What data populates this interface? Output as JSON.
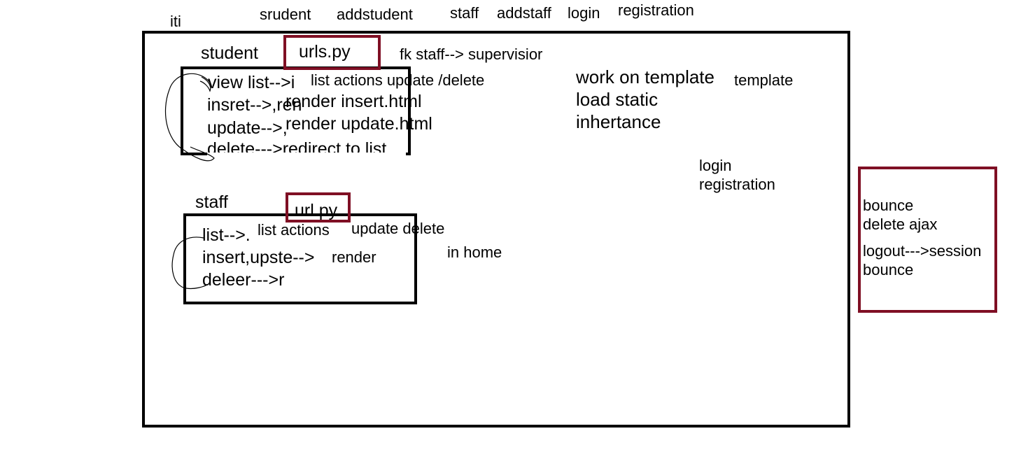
{
  "title": "iti",
  "top_nav": [
    "srudent",
    "addstudent",
    "staff",
    "addstaff",
    "login",
    "registration"
  ],
  "student": {
    "heading": "student",
    "urls_label": "urls.py",
    "fk_note": "fk staff--> supervisior",
    "list_actions": "list actions update /delete",
    "items": [
      "view list-->i",
      "insret-->,ren",
      "update-->,",
      "delete--->redirect to list"
    ],
    "render_insert": "render insert.html",
    "render_update": "render update.html"
  },
  "template_notes": {
    "work": "work on template",
    "load": "load static",
    "inh": "inhertance",
    "template_label": "template"
  },
  "auth_notes": {
    "login": "login",
    "registration": "registration"
  },
  "staff": {
    "heading": "staff",
    "url_label": "url.py",
    "list_actions": "list actions",
    "update_delete": "update delete",
    "items": [
      "list-->.",
      "insert,upste-->",
      "deleer--->r"
    ],
    "render": "render",
    "in_home": "in home"
  },
  "side": {
    "bounce1": "bounce",
    "delete_ajax": "delete ajax",
    "logout": "logout--->session",
    "bounce2": "bounce"
  },
  "colors": {
    "ink": "#000000",
    "accent": "#7f0f24",
    "paper": "#ffffff"
  }
}
